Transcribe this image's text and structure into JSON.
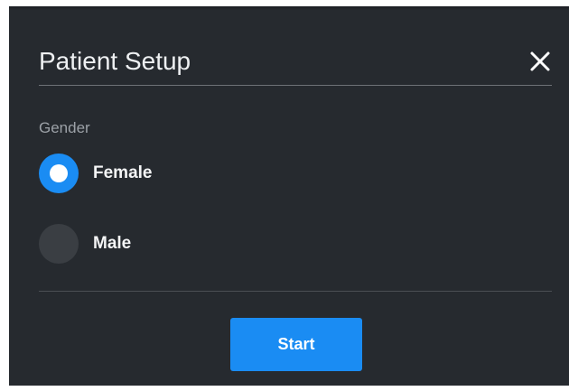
{
  "dialog": {
    "title": "Patient Setup",
    "close_icon": "close-icon",
    "gender": {
      "label": "Gender",
      "options": [
        {
          "label": "Female",
          "selected": true
        },
        {
          "label": "Male",
          "selected": false
        }
      ]
    },
    "start_label": "Start"
  },
  "colors": {
    "background": "#262a2f",
    "accent": "#1a8cf3",
    "divider": "#6d7176",
    "radio_unchecked": "#3a3e43"
  }
}
